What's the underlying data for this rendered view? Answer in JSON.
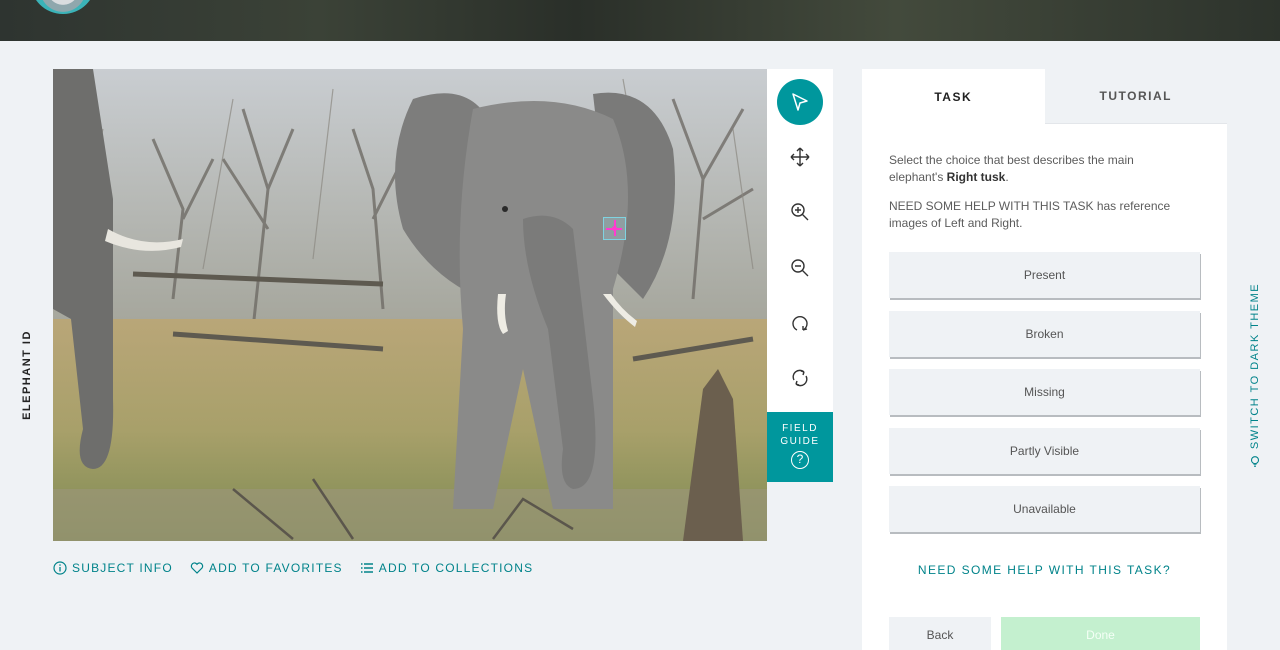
{
  "header": {
    "avatar": "project-avatar"
  },
  "project": {
    "title": "ELEPHANT ID"
  },
  "subject": {
    "alt": "elephant-photo"
  },
  "toolbar": {
    "tools": [
      "pointer-icon",
      "move-icon",
      "zoom-in-icon",
      "zoom-out-icon",
      "rotate-icon",
      "reset-icon"
    ],
    "field_guide_label": "FIELD GUIDE",
    "field_guide_icon": "?"
  },
  "meta": {
    "subject_info": "SUBJECT INFO",
    "add_to_favorites": "ADD TO FAVORITES",
    "add_to_collections": "ADD TO COLLECTIONS"
  },
  "panel": {
    "tabs": [
      {
        "label": "TASK",
        "active": true
      },
      {
        "label": "TUTORIAL",
        "active": false
      }
    ],
    "question_pre": "Select the choice that best describes the main elephant's ",
    "question_bold": "Right tusk",
    "question_post": ".",
    "help_note": "NEED SOME HELP WITH THIS TASK has reference images of Left and Right.",
    "answers": [
      "Present",
      "Broken",
      "Missing",
      "Partly Visible",
      "Unavailable"
    ],
    "help_link": "NEED SOME HELP WITH THIS TASK?",
    "back_label": "Back",
    "done_label": "Done"
  },
  "theme_switch": {
    "label": "SWITCH TO DARK THEME"
  },
  "colors": {
    "accent": "#00979d",
    "link": "#00838a",
    "background": "#eff2f5",
    "done": "#c4f0cf"
  }
}
